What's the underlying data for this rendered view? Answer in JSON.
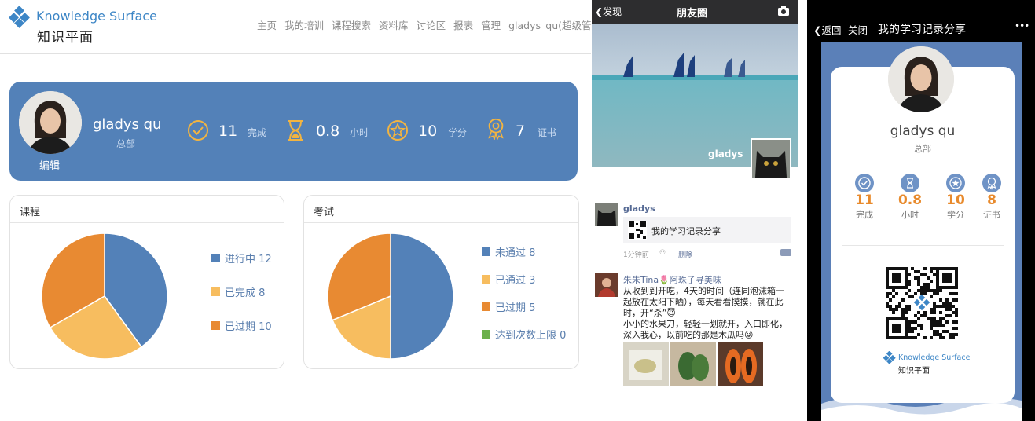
{
  "colors": {
    "blue": "#5381b8",
    "light_orange": "#f7bd5f",
    "orange": "#e88a32",
    "green": "#6cb04c",
    "brand_blue": "#3d86c6",
    "stat_gold": "#f2b441"
  },
  "site": {
    "brand_en": "Knowledge Surface",
    "brand_cn": "知识平面"
  },
  "nav": [
    "主页",
    "我的培训",
    "课程搜索",
    "资料库",
    "讨论区",
    "报表",
    "管理",
    "gladys_qu(超级管理员)"
  ],
  "profile": {
    "name": "gladys qu",
    "dept": "总部",
    "edit_label": "编辑"
  },
  "stats": [
    {
      "icon": "check-circle-icon",
      "value": "11",
      "label": "完成"
    },
    {
      "icon": "hourglass-icon",
      "value": "0.8",
      "label": "小时"
    },
    {
      "icon": "star-circle-icon",
      "value": "10",
      "label": "学分"
    },
    {
      "icon": "medal-icon",
      "value": "7",
      "label": "证书"
    }
  ],
  "courses_card": {
    "title": "课程"
  },
  "exam_card": {
    "title": "考试"
  },
  "chart_data": [
    {
      "type": "pie",
      "title": "课程",
      "categories": [
        "进行中",
        "已完成",
        "已过期"
      ],
      "values": [
        12,
        8,
        10
      ],
      "colors": [
        "#5381b8",
        "#f7bd5f",
        "#e88a32"
      ]
    },
    {
      "type": "pie",
      "title": "考试",
      "categories": [
        "未通过",
        "已通过",
        "已过期",
        "达到次数上限"
      ],
      "values": [
        8,
        3,
        5,
        0
      ],
      "colors": [
        "#5381b8",
        "#f7bd5f",
        "#e88a32",
        "#6cb04c"
      ]
    }
  ],
  "moments": {
    "back_label": "发现",
    "title": "朋友圈",
    "cover_name": "gladys",
    "post1": {
      "user": "gladys",
      "share_text": "我的学习记录分享",
      "time": "1分钟前",
      "delete_label": "删除"
    },
    "post2": {
      "user": "朱朱Tina🌷阿珠子寻美味",
      "text": "从收到到开吃，4天的时间（连同泡沫箱一起放在太阳下晒），每天看看摸摸，就在此时，开“杀”😇\n小小的水果刀，轻轻一划就开，入口即化，深入我心，以前吃的那是木瓜吗😜"
    }
  },
  "share": {
    "back_label": "返回",
    "close_label": "关闭",
    "title": "我的学习记录分享",
    "more_label": "•••",
    "name": "gladys qu",
    "dept": "总部",
    "stats": [
      {
        "icon": "check-circle-icon",
        "value": "11",
        "label": "完成"
      },
      {
        "icon": "hourglass-icon",
        "value": "0.8",
        "label": "小时"
      },
      {
        "icon": "star-circle-icon",
        "value": "10",
        "label": "学分"
      },
      {
        "icon": "medal-icon",
        "value": "8",
        "label": "证书"
      }
    ],
    "brand_en": "Knowledge Surface",
    "brand_cn": "知识平面"
  }
}
